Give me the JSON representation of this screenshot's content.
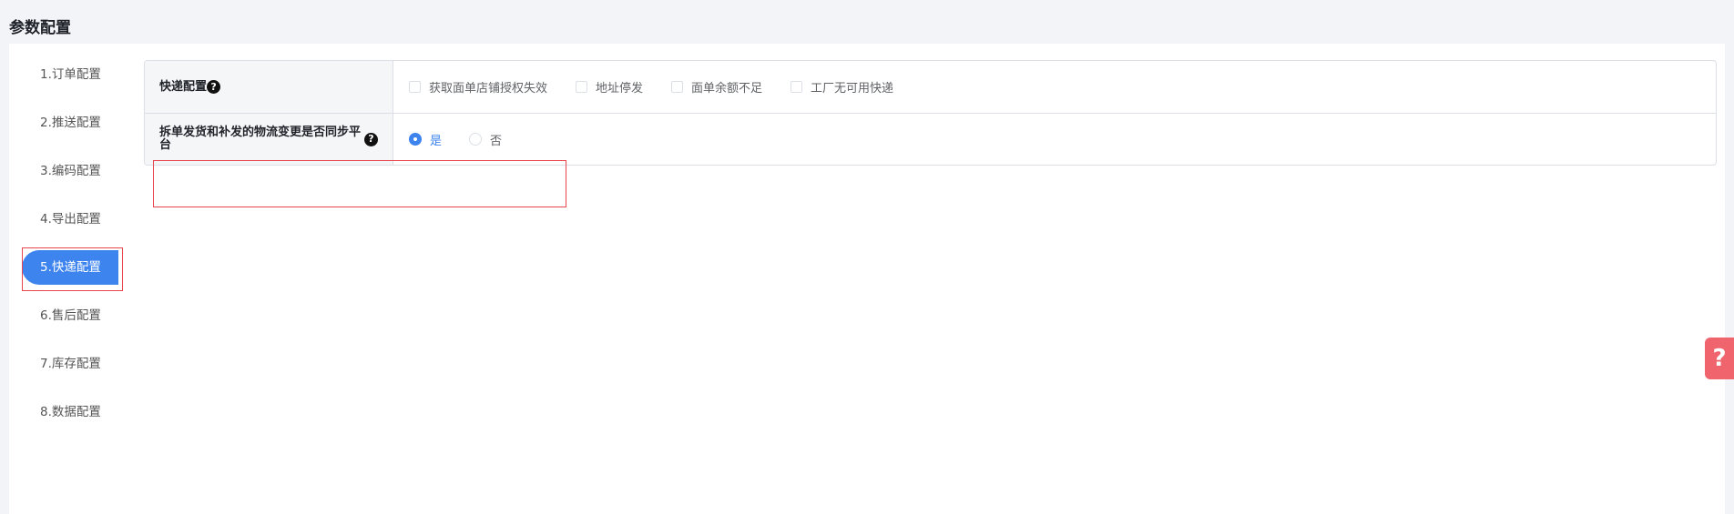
{
  "page": {
    "title": "参数配置"
  },
  "sidebar": {
    "items": [
      {
        "label": "1.订单配置"
      },
      {
        "label": "2.推送配置"
      },
      {
        "label": "3.编码配置"
      },
      {
        "label": "4.导出配置"
      },
      {
        "label": "5.快递配置",
        "active": true
      },
      {
        "label": "6.售后配置"
      },
      {
        "label": "7.库存配置"
      },
      {
        "label": "8.数据配置"
      }
    ]
  },
  "config": {
    "rows": [
      {
        "label": "快递配置",
        "options": [
          "获取面单店铺授权失效",
          "地址停发",
          "面单余额不足",
          "工厂无可用快递"
        ]
      },
      {
        "label": "拆单发货和补发的物流变更是否同步平台",
        "radios": [
          {
            "label": "是",
            "checked": true
          },
          {
            "label": "否",
            "checked": false
          }
        ]
      }
    ]
  },
  "icons": {
    "help": "question-circle-icon",
    "help_glyph": "?"
  },
  "colors": {
    "accent": "#3d84ef",
    "highlight": "#e8454f",
    "float_help": "#f0646d"
  }
}
